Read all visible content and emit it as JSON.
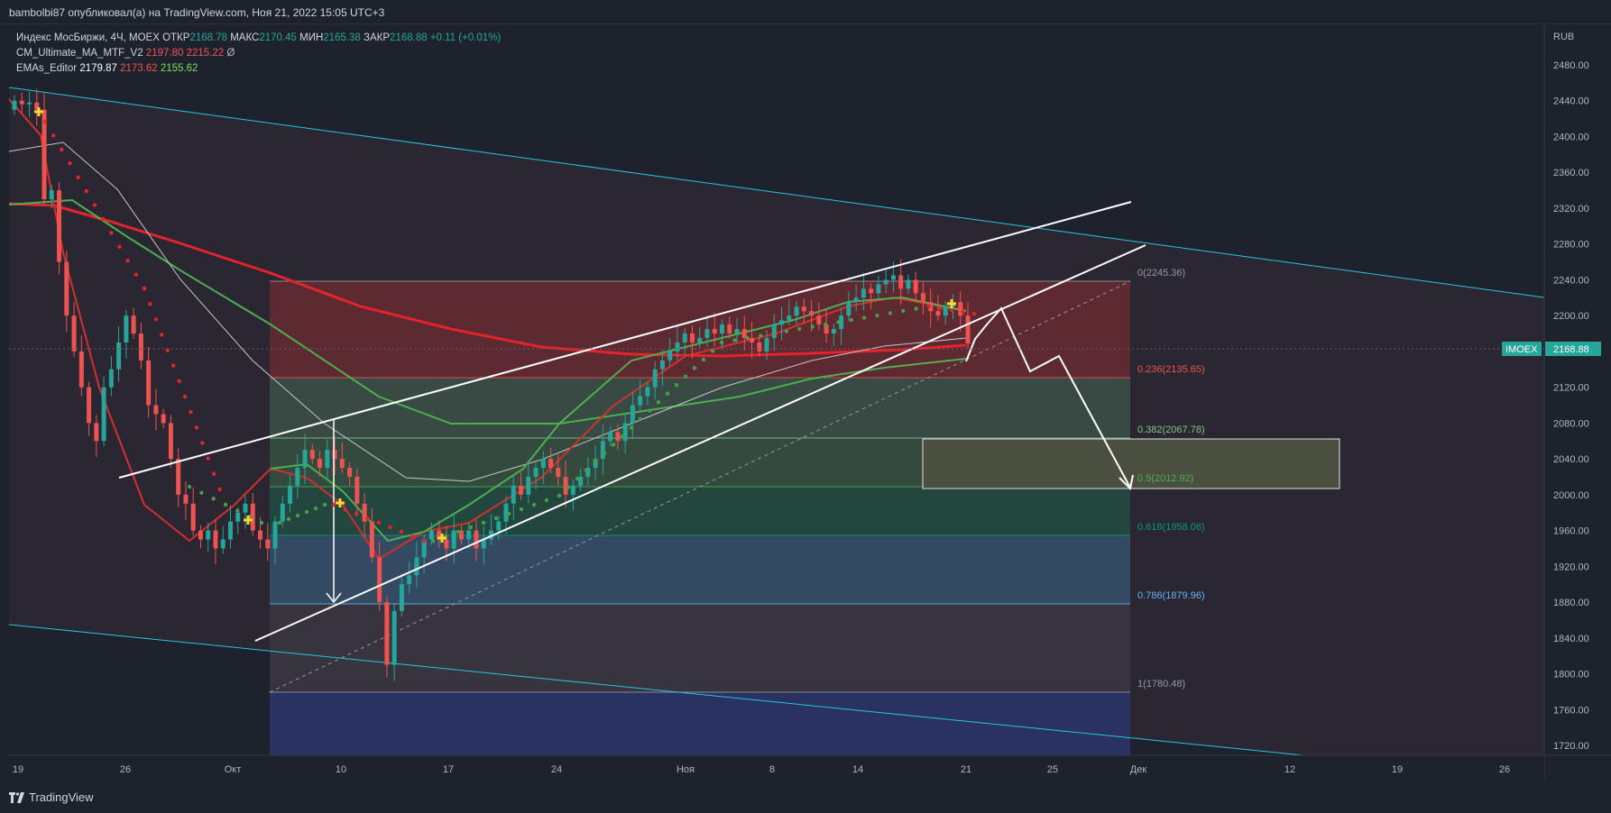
{
  "header": {
    "publisher": "bambolbi87 опубликовал(а) на TradingView.com, Ноя 21, 2022 15:05 UTC+3"
  },
  "legend": {
    "symbol_line": {
      "label": "Индекс МосБиржи, 4Ч, MOEX",
      "open_label": "ОТКР",
      "open": "2168.78",
      "high_label": "МАКС",
      "high": "2170.45",
      "low_label": "МИН",
      "low": "2165.38",
      "close_label": "ЗАКР",
      "close": "2168.88",
      "change": "+0.11 (+0.01%)"
    },
    "indicator1": {
      "label": "CM_Ultimate_MA_MTF_V2",
      "v1": "2197.80",
      "v2": "2215.22",
      "v3": "Ø"
    },
    "indicator2": {
      "label": "EMAs_Editor",
      "v1": "2179.87",
      "v2": "2173.62",
      "v3": "2155.62"
    }
  },
  "price_axis": {
    "currency": "RUB",
    "ticks": [
      "2480.00",
      "2440.00",
      "2400.00",
      "2360.00",
      "2320.00",
      "2280.00",
      "2240.00",
      "2200.00",
      "2160.00",
      "2120.00",
      "2080.00",
      "2040.00",
      "2000.00",
      "1960.00",
      "1920.00",
      "1880.00",
      "1840.00",
      "1800.00",
      "1760.00",
      "1720.00"
    ],
    "last_price_symbol": "IMOEX",
    "last_price": "2168.88"
  },
  "time_axis": {
    "ticks": [
      "19",
      "26",
      "Окт",
      "10",
      "17",
      "24",
      "Ноя",
      "8",
      "14",
      "21",
      "25",
      "Дек",
      "12",
      "19",
      "26"
    ]
  },
  "fib_levels": [
    {
      "label": "0(2245.36)",
      "color": "#9598a1"
    },
    {
      "label": "0.236(2135.65)",
      "color": "#ef5350"
    },
    {
      "label": "0.382(2067.78)",
      "color": "#81c784"
    },
    {
      "label": "0.5(2012.92)",
      "color": "#4caf50"
    },
    {
      "label": "0.618(1958.06)",
      "color": "#089981"
    },
    {
      "label": "0.786(1879.96)",
      "color": "#64b5f6"
    },
    {
      "label": "1(1780.48)",
      "color": "#9598a1"
    }
  ],
  "chart_data": {
    "type": "candlestick",
    "symbol": "IMOEX",
    "interval": "4Ч",
    "ylim": [
      1720,
      2490
    ],
    "last_price": 2168.88,
    "fib_retracement": [
      2245.36,
      2135.65,
      2067.78,
      2012.92,
      1958.06,
      1879.96,
      1780.48
    ],
    "sampled_closes": [
      {
        "x": "19",
        "y": 2440
      },
      {
        "x": "21",
        "y": 2330
      },
      {
        "x": "23",
        "y": 2080
      },
      {
        "x": "26",
        "y": 2010
      },
      {
        "x": "28",
        "y": 1960
      },
      {
        "x": "Окт",
        "y": 2040
      },
      {
        "x": "10",
        "y": 1880
      },
      {
        "x": "13",
        "y": 1940
      },
      {
        "x": "17",
        "y": 1960
      },
      {
        "x": "20",
        "y": 2010
      },
      {
        "x": "24",
        "y": 2060
      },
      {
        "x": "27",
        "y": 2130
      },
      {
        "x": "Ноя",
        "y": 2180
      },
      {
        "x": "4",
        "y": 2170
      },
      {
        "x": "8",
        "y": 2200
      },
      {
        "x": "11",
        "y": 2215
      },
      {
        "x": "14",
        "y": 2230
      },
      {
        "x": "16",
        "y": 2240
      },
      {
        "x": "18",
        "y": 2215
      },
      {
        "x": "21",
        "y": 2168.88
      }
    ],
    "colors": {
      "up": "#26a69a",
      "down": "#ef5350",
      "ma_red": "#e4232b",
      "ma_green": "#4caf50",
      "ma_white": "#c7c7c7",
      "channel": "#26c6da",
      "trend": "#ffffff"
    },
    "grid": false
  },
  "footer": {
    "brand": "TradingView"
  }
}
